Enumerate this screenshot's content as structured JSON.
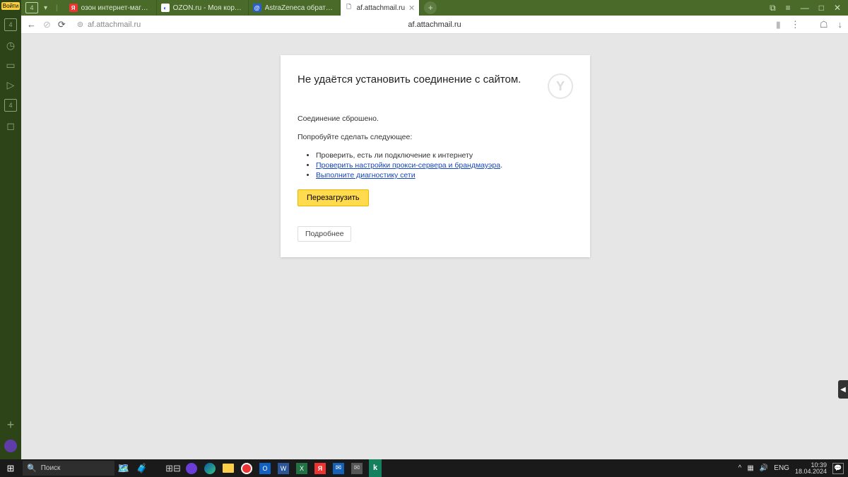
{
  "sidepanel": {
    "login": "Войти",
    "badge": "4",
    "badge2": "4"
  },
  "tabs": {
    "counter": "4",
    "items": [
      {
        "title": "озон интернет-магазин о"
      },
      {
        "title": "OZON.ru - Моя корзина"
      },
      {
        "title": "AstraZeneca обратилась"
      },
      {
        "title": "af.attachmail.ru"
      }
    ]
  },
  "address": {
    "url": "af.attachmail.ru",
    "center": "af.attachmail.ru"
  },
  "error": {
    "title": "Не удаётся установить соединение с сайтом.",
    "subtitle": "Соединение сброшено.",
    "try": "Попробуйте сделать следующее:",
    "suggestions": [
      "Проверить, есть ли подключение к интернету",
      "Проверить настройки прокси-сервера и брандмауэра",
      "Выполните диагностику сети"
    ],
    "reload": "Перезагрузить",
    "details": "Подробнее"
  },
  "taskbar": {
    "search": "Поиск",
    "lang": "ENG",
    "time": "10:39",
    "date": "18.04.2024"
  }
}
